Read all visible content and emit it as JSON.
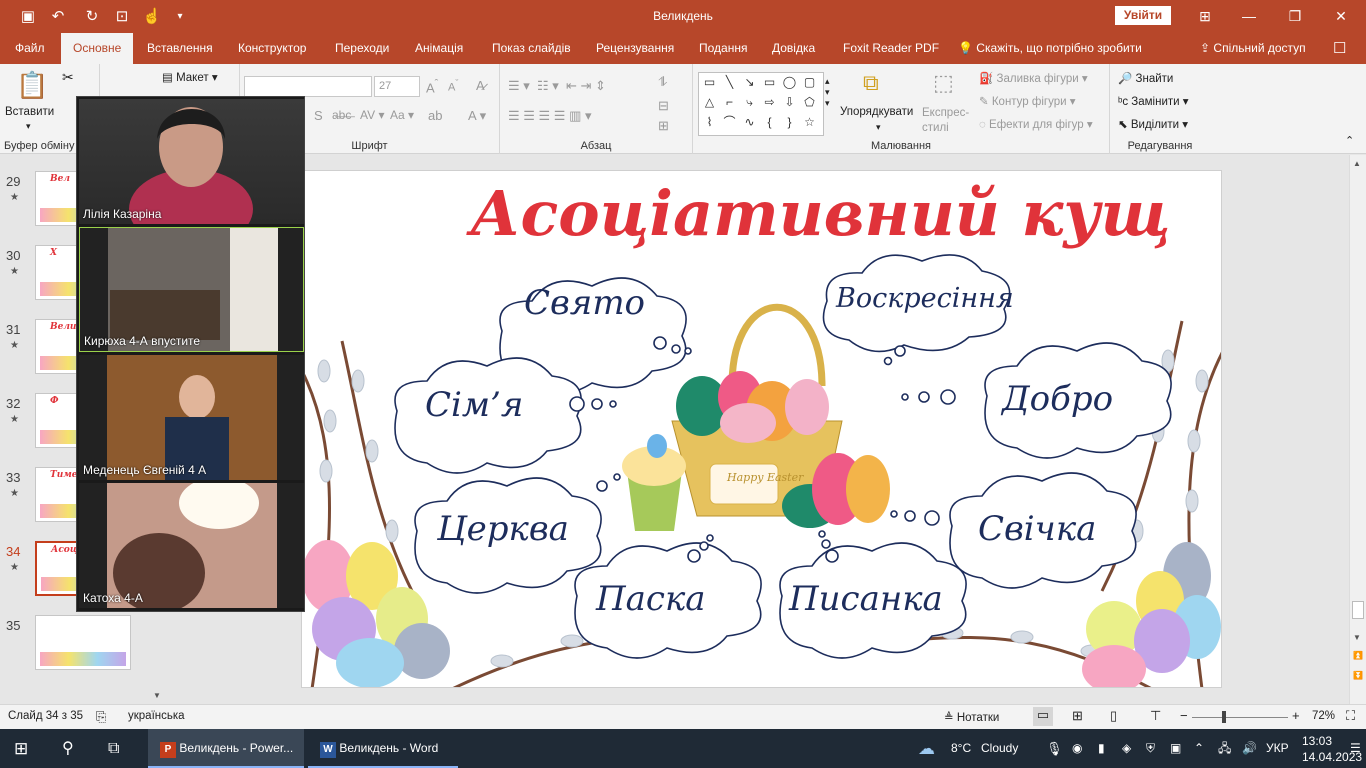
{
  "window": {
    "title": "Великдень",
    "signin_label": "Увійти",
    "qat_icons": [
      "save-icon",
      "undo-icon",
      "redo-icon",
      "present-icon",
      "touch-icon",
      "customize-icon"
    ]
  },
  "tabs": [
    "Файл",
    "Основне",
    "Вставлення",
    "Конструктор",
    "Переходи",
    "Анімація",
    "Показ слайдів",
    "Рецензування",
    "Подання",
    "Довідка",
    "Foxit Reader PDF"
  ],
  "active_tab": "Основне",
  "tell_me": "Скажіть, що потрібно зробити",
  "share": "Спільний доступ",
  "ribbon": {
    "clipboard": {
      "paste": "Вставити",
      "label": "Буфер обміну"
    },
    "slides": {
      "layout": "Макет"
    },
    "font": {
      "label": "Шрифт",
      "size": "27"
    },
    "paragraph": {
      "label": "Абзац"
    },
    "drawing": {
      "arrange": "Упорядкувати",
      "quick_styles": "Експрес-стилі",
      "fill": "Заливка фігури",
      "outline": "Контур фігури",
      "effects": "Ефекти для фігур",
      "label": "Малювання"
    },
    "editing": {
      "find": "Знайти",
      "replace": "Замінити",
      "select": "Виділити",
      "label": "Редагування"
    }
  },
  "thumbnails": [
    {
      "num": "29",
      "text": "Вел"
    },
    {
      "num": "30",
      "text": "Х"
    },
    {
      "num": "31",
      "text": "Вели"
    },
    {
      "num": "32",
      "text": "Ф"
    },
    {
      "num": "33",
      "text": "Тиме"
    },
    {
      "num": "34",
      "text": "Асоц"
    },
    {
      "num": "35",
      "text": ""
    }
  ],
  "selected_slide": "34",
  "slide": {
    "title": "Асоціативний кущ",
    "clouds": [
      "Свято",
      "Воскресіння",
      "Сім’я",
      "Добро",
      "Церква",
      "Свічка",
      "Паска",
      "Писанка"
    ],
    "basket_tag": "Happy Easter"
  },
  "zoom_participants": [
    "Лілія Казаріна",
    "Кирюха 4-А впустите",
    "Меденець Євгеній 4 А",
    "Катоха 4-А"
  ],
  "status": {
    "slide": "Слайд 34 з 35",
    "language": "українська",
    "notes": "Нотатки",
    "zoom": "72%"
  },
  "taskbar": {
    "apps": [
      "Великдень - Power...",
      "Великдень - Word"
    ],
    "weather_temp": "8°C",
    "weather": "Cloudy",
    "lang": "УКР",
    "time": "13:03",
    "date": "14.04.2023"
  },
  "colors": {
    "accent": "#b7472a",
    "title_red": "#e0333a",
    "cloud_text": "#1d2d5c"
  }
}
